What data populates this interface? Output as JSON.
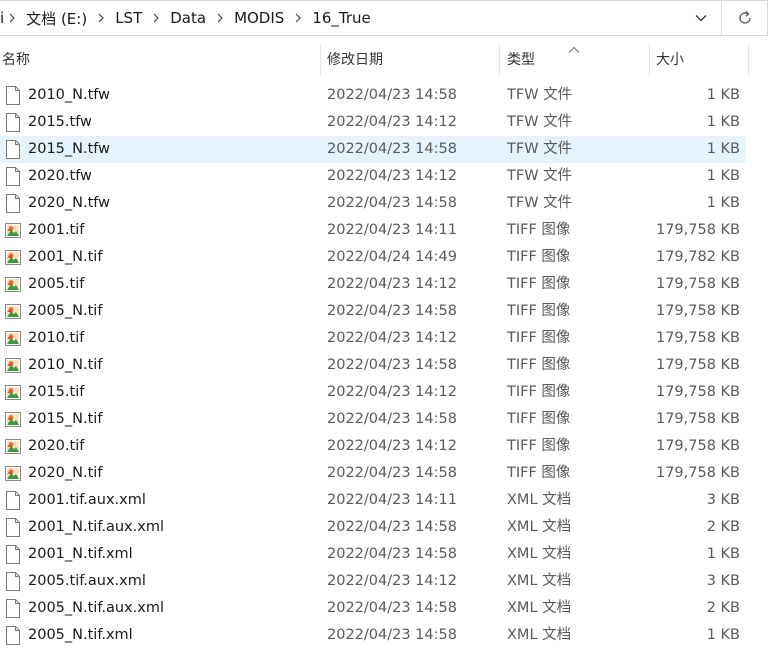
{
  "address": {
    "crumbs": [
      "文档 (E:)",
      "LST",
      "Data",
      "MODIS",
      "16_True"
    ],
    "first_fragment": "i"
  },
  "columns": {
    "name": "名称",
    "date": "修改日期",
    "type": "类型",
    "size": "大小"
  },
  "files": [
    {
      "name": "2010_N.tfw",
      "date": "2022/04/23 14:58",
      "type": "TFW 文件",
      "size": "1 KB",
      "icon": "generic-file-icon"
    },
    {
      "name": "2015.tfw",
      "date": "2022/04/23 14:12",
      "type": "TFW 文件",
      "size": "1 KB",
      "icon": "generic-file-icon"
    },
    {
      "name": "2015_N.tfw",
      "date": "2022/04/23 14:58",
      "type": "TFW 文件",
      "size": "1 KB",
      "icon": "generic-file-icon",
      "selected": true
    },
    {
      "name": "2020.tfw",
      "date": "2022/04/23 14:12",
      "type": "TFW 文件",
      "size": "1 KB",
      "icon": "generic-file-icon"
    },
    {
      "name": "2020_N.tfw",
      "date": "2022/04/23 14:58",
      "type": "TFW 文件",
      "size": "1 KB",
      "icon": "generic-file-icon"
    },
    {
      "name": "2001.tif",
      "date": "2022/04/23 14:11",
      "type": "TIFF 图像",
      "size": "179,758 KB",
      "icon": "image-file-icon"
    },
    {
      "name": "2001_N.tif",
      "date": "2022/04/24 14:49",
      "type": "TIFF 图像",
      "size": "179,782 KB",
      "icon": "image-file-icon"
    },
    {
      "name": "2005.tif",
      "date": "2022/04/23 14:12",
      "type": "TIFF 图像",
      "size": "179,758 KB",
      "icon": "image-file-icon"
    },
    {
      "name": "2005_N.tif",
      "date": "2022/04/23 14:58",
      "type": "TIFF 图像",
      "size": "179,758 KB",
      "icon": "image-file-icon"
    },
    {
      "name": "2010.tif",
      "date": "2022/04/23 14:12",
      "type": "TIFF 图像",
      "size": "179,758 KB",
      "icon": "image-file-icon"
    },
    {
      "name": "2010_N.tif",
      "date": "2022/04/23 14:58",
      "type": "TIFF 图像",
      "size": "179,758 KB",
      "icon": "image-file-icon"
    },
    {
      "name": "2015.tif",
      "date": "2022/04/23 14:12",
      "type": "TIFF 图像",
      "size": "179,758 KB",
      "icon": "image-file-icon"
    },
    {
      "name": "2015_N.tif",
      "date": "2022/04/23 14:58",
      "type": "TIFF 图像",
      "size": "179,758 KB",
      "icon": "image-file-icon"
    },
    {
      "name": "2020.tif",
      "date": "2022/04/23 14:12",
      "type": "TIFF 图像",
      "size": "179,758 KB",
      "icon": "image-file-icon"
    },
    {
      "name": "2020_N.tif",
      "date": "2022/04/23 14:58",
      "type": "TIFF 图像",
      "size": "179,758 KB",
      "icon": "image-file-icon"
    },
    {
      "name": "2001.tif.aux.xml",
      "date": "2022/04/23 14:11",
      "type": "XML 文档",
      "size": "3 KB",
      "icon": "generic-file-icon"
    },
    {
      "name": "2001_N.tif.aux.xml",
      "date": "2022/04/23 14:58",
      "type": "XML 文档",
      "size": "2 KB",
      "icon": "generic-file-icon"
    },
    {
      "name": "2001_N.tif.xml",
      "date": "2022/04/23 14:58",
      "type": "XML 文档",
      "size": "1 KB",
      "icon": "generic-file-icon"
    },
    {
      "name": "2005.tif.aux.xml",
      "date": "2022/04/23 14:12",
      "type": "XML 文档",
      "size": "3 KB",
      "icon": "generic-file-icon"
    },
    {
      "name": "2005_N.tif.aux.xml",
      "date": "2022/04/23 14:58",
      "type": "XML 文档",
      "size": "2 KB",
      "icon": "generic-file-icon"
    },
    {
      "name": "2005_N.tif.xml",
      "date": "2022/04/23 14:58",
      "type": "XML 文档",
      "size": "1 KB",
      "icon": "generic-file-icon"
    }
  ],
  "colors": {
    "selected_row": "#e5f3ff",
    "image_icon_orange": "#e8742a",
    "image_icon_green": "#3b9a3b"
  }
}
